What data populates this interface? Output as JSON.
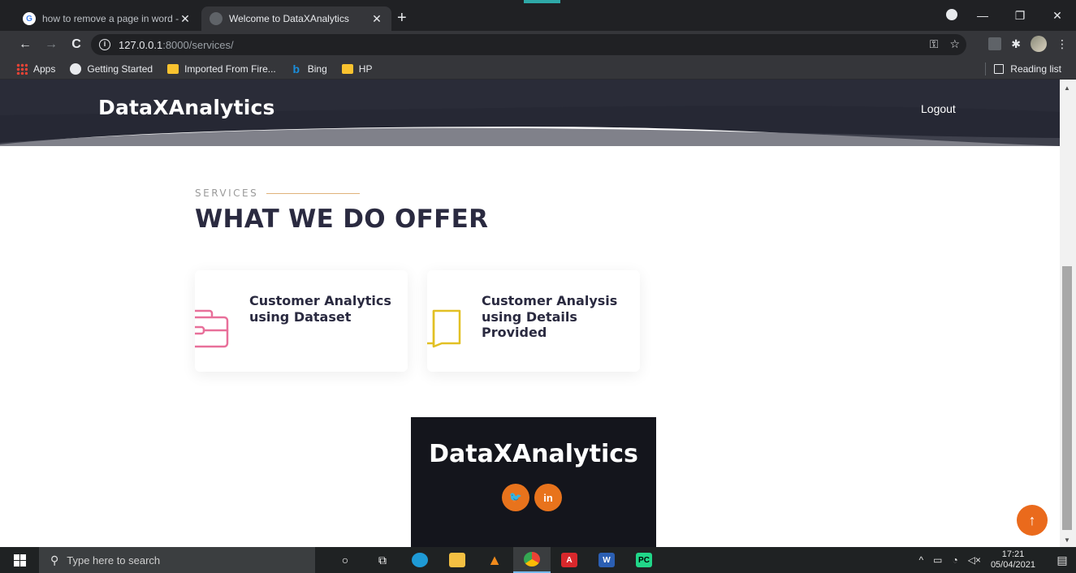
{
  "browser": {
    "tabs": [
      {
        "title": "how to remove a page in word -",
        "close": "✕",
        "active": false,
        "favicon": "google-icon"
      },
      {
        "title": "Welcome to DataXAnalytics",
        "close": "✕",
        "active": true,
        "favicon": "globe-icon"
      }
    ],
    "new_tab": "+",
    "url_host": "127.0.0.1",
    "url_path": ":8000/services/",
    "bookmarks": [
      {
        "label": "Apps",
        "icon": "apps-grid-icon"
      },
      {
        "label": "Getting Started",
        "icon": "globe-icon"
      },
      {
        "label": "Imported From Fire...",
        "icon": "folder-icon"
      },
      {
        "label": "Bing",
        "icon": "bing-icon"
      },
      {
        "label": "HP",
        "icon": "folder-icon"
      }
    ],
    "reading_list": "Reading list"
  },
  "site": {
    "brand": "DataXAnalytics",
    "nav_logout": "Logout",
    "header_color": "#262834",
    "section_tag": "SERVICES",
    "section_title": "WHAT WE DO OFFER",
    "services": [
      {
        "label": "Customer Analytics using Dataset",
        "icon": "briefcase-icon",
        "icon_color": "#e8709a"
      },
      {
        "label": "Customer Analysis using Details Provided",
        "icon": "book-icon",
        "icon_color": "#e2c024"
      }
    ],
    "footer_brand": "DataXAnalytics",
    "footer_bg": "#14151c",
    "socials": [
      {
        "name": "twitter",
        "glyph": "🐦"
      },
      {
        "name": "linkedin",
        "glyph": "in"
      }
    ],
    "accent_color": "#e8731c"
  },
  "taskbar": {
    "search_placeholder": "Type here to search",
    "time": "17:21",
    "date": "05/04/2021"
  }
}
